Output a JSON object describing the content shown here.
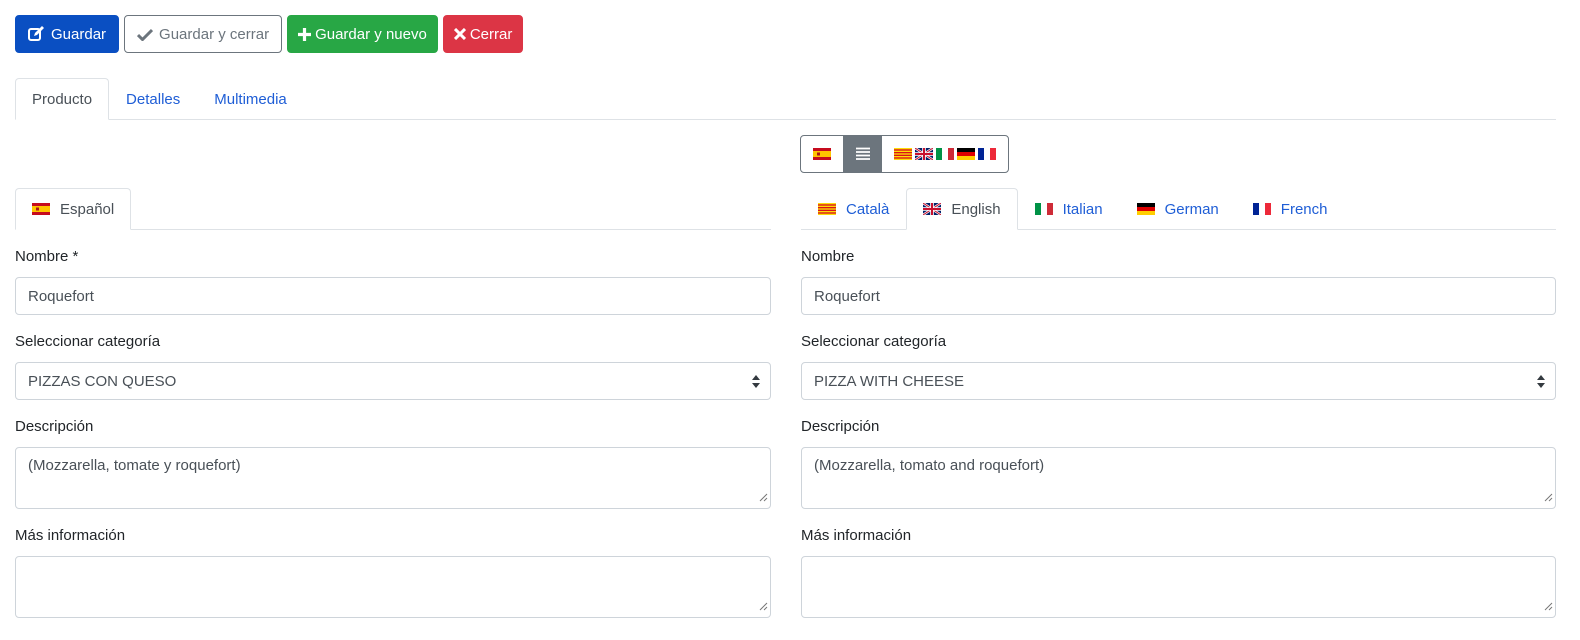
{
  "toolbar": {
    "save_label": "Guardar",
    "save_close_label": "Guardar y cerrar",
    "save_new_label": "Guardar y nuevo",
    "close_label": "Cerrar"
  },
  "main_tabs": [
    {
      "label": "Producto",
      "active": true
    },
    {
      "label": "Detalles",
      "active": false
    },
    {
      "label": "Multimedia",
      "active": false
    }
  ],
  "view_toggle": {
    "options": [
      "spain-flag",
      "list-icon",
      "other-languages-flags"
    ],
    "selected": "list-icon"
  },
  "left_panel": {
    "lang_tabs": [
      {
        "label": "Español",
        "flag": "spain-flag",
        "active": true
      }
    ],
    "name_label": "Nombre *",
    "name_value": "Roquefort",
    "category_label": "Seleccionar categoría",
    "category_value": "PIZZAS CON QUESO",
    "description_label": "Descripción",
    "description_value": "(Mozzarella, tomate y roquefort)",
    "more_info_label": "Más información",
    "more_info_value": ""
  },
  "right_panel": {
    "lang_tabs": [
      {
        "label": "Català",
        "flag": "catalonia-flag",
        "active": false
      },
      {
        "label": "English",
        "flag": "uk-flag",
        "active": true
      },
      {
        "label": "Italian",
        "flag": "italy-flag",
        "active": false
      },
      {
        "label": "German",
        "flag": "germany-flag",
        "active": false
      },
      {
        "label": "French",
        "flag": "france-flag",
        "active": false
      }
    ],
    "name_label": "Nombre",
    "name_value": "Roquefort",
    "category_label": "Seleccionar categoría",
    "category_value": "PIZZA WITH CHEESE",
    "description_label": "Descripción",
    "description_value": "(Mozzarella, tomato and roquefort)",
    "more_info_label": "Más información",
    "more_info_value": ""
  },
  "colors": {
    "primary": "#0a4fc2",
    "success": "#28a745",
    "danger": "#dc3545",
    "secondary": "#6c757d",
    "link": "#1f5ed6"
  }
}
